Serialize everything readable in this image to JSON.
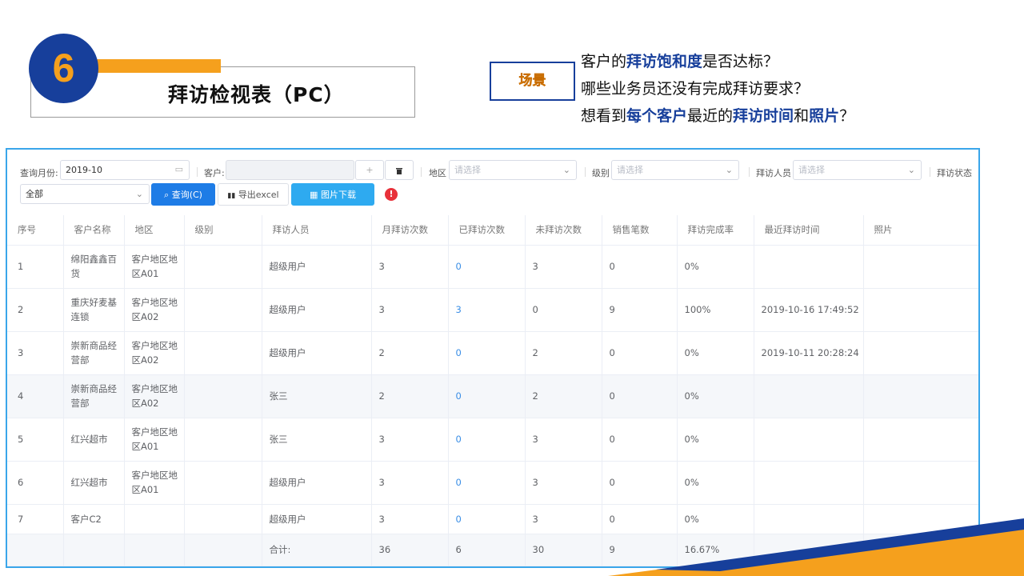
{
  "header": {
    "number": "6",
    "title": "拜访检视表（PC）",
    "scene_label": "场景",
    "questions": [
      [
        {
          "t": "客户的",
          "hl": false
        },
        {
          "t": "拜访饱和度",
          "hl": true
        },
        {
          "t": "是否达标？",
          "hl": false
        }
      ],
      [
        {
          "t": "哪些业务员还没有完成拜访要求？",
          "hl": false
        }
      ],
      [
        {
          "t": "想看到",
          "hl": false
        },
        {
          "t": "每个客户",
          "hl": true
        },
        {
          "t": "最近的",
          "hl": false
        },
        {
          "t": "拜访时间",
          "hl": true
        },
        {
          "t": "和",
          "hl": false
        },
        {
          "t": "照片",
          "hl": true
        },
        {
          "t": "？",
          "hl": false
        }
      ]
    ]
  },
  "filters": {
    "month_label": "查询月份:",
    "month_value": "2019-10",
    "customer_label": "客户:",
    "add_icon": "+",
    "delete_icon": "trash-icon",
    "region_label": "地区",
    "region_placeholder": "请选择",
    "level_label": "级别",
    "level_placeholder": "请选择",
    "visitor_label": "拜访人员",
    "visitor_placeholder": "请选择",
    "status_label": "拜访状态",
    "status_value": "全部",
    "query_button": "查询(C)",
    "export_button": "导出excel",
    "download_button": "图片下载"
  },
  "table": {
    "columns": [
      "序号",
      "客户名称",
      "地区",
      "级别",
      "拜访人员",
      "月拜访次数",
      "已拜访次数",
      "未拜访次数",
      "销售笔数",
      "拜访完成率",
      "最近拜访时间",
      "照片"
    ],
    "rows": [
      [
        "1",
        "绵阳鑫鑫百货",
        "客户地区地区A01",
        "",
        "超级用户",
        "3",
        "0",
        "3",
        "0",
        "0%",
        "",
        ""
      ],
      [
        "2",
        "重庆好麦基连锁",
        "客户地区地区A02",
        "",
        "超级用户",
        "3",
        "3",
        "0",
        "9",
        "100%",
        "2019-10-16 17:49:52",
        ""
      ],
      [
        "3",
        "崇新商品经营部",
        "客户地区地区A02",
        "",
        "超级用户",
        "2",
        "0",
        "2",
        "0",
        "0%",
        "2019-10-11 20:28:24",
        ""
      ],
      [
        "4",
        "崇新商品经营部",
        "客户地区地区A02",
        "",
        "张三",
        "2",
        "0",
        "2",
        "0",
        "0%",
        "",
        ""
      ],
      [
        "5",
        "红兴超市",
        "客户地区地区A01",
        "",
        "张三",
        "3",
        "0",
        "3",
        "0",
        "0%",
        "",
        ""
      ],
      [
        "6",
        "红兴超市",
        "客户地区地区A01",
        "",
        "超级用户",
        "3",
        "0",
        "3",
        "0",
        "0%",
        "",
        ""
      ],
      [
        "7",
        "客户C2",
        "",
        "",
        "超级用户",
        "3",
        "0",
        "3",
        "0",
        "0%",
        "",
        ""
      ]
    ],
    "summary": [
      "",
      "",
      "",
      "",
      "合计:",
      "36",
      "6",
      "30",
      "9",
      "16.67%",
      "",
      ""
    ]
  },
  "colors": {
    "brand_blue": "#173f9b",
    "accent_orange": "#f5a01d",
    "primary_button": "#1e7ce6",
    "panel_border": "#3aa6ea",
    "link": "#3a8ee6"
  }
}
